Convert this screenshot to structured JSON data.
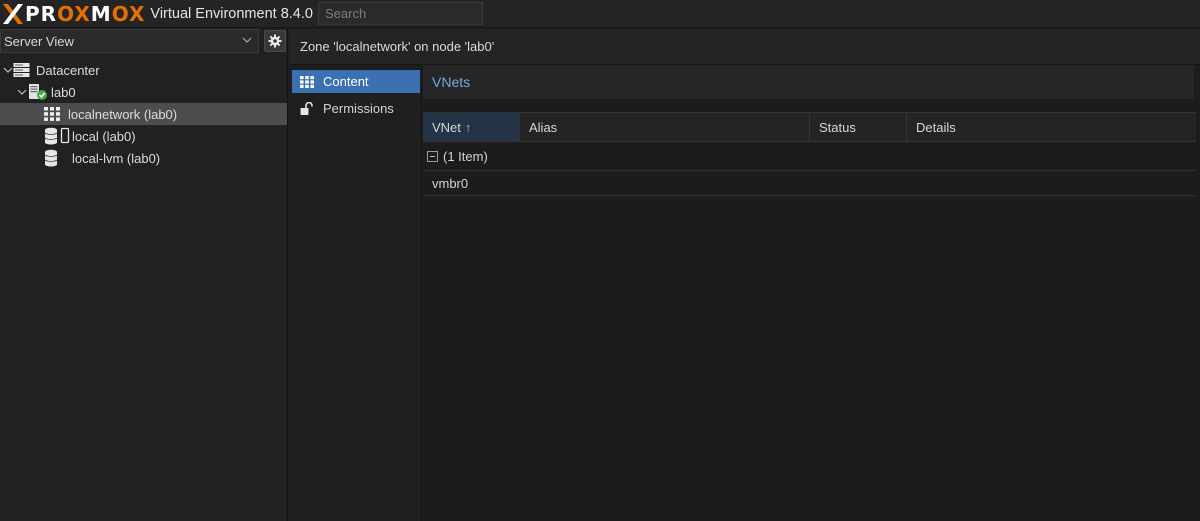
{
  "app": {
    "brand_prefix": "PR",
    "brand_ox1": "OX",
    "brand_m": "M",
    "brand_ox2": "OX",
    "title": "Virtual Environment 8.4.0",
    "search_placeholder": "Search"
  },
  "colors": {
    "accent_orange": "#e57000",
    "selected_blue": "#3b70b3",
    "panel_title_blue": "#78a9e2",
    "status_green": "#3fae49"
  },
  "left": {
    "view_selector": "Server View",
    "tree": [
      {
        "label": "Datacenter",
        "icon": "server-rack-icon"
      },
      {
        "label": "lab0",
        "icon": "node-online-icon"
      },
      {
        "label": "localnetwork (lab0)",
        "icon": "sdn-zone-grid-icon",
        "selected": true
      },
      {
        "label": "local (lab0)",
        "icon": "storage-database-icon"
      },
      {
        "label": "local-lvm (lab0)",
        "icon": "storage-database-icon"
      }
    ]
  },
  "main": {
    "header": "Zone 'localnetwork' on node 'lab0'",
    "nav": [
      {
        "label": "Content",
        "icon": "grid-icon",
        "active": true
      },
      {
        "label": "Permissions",
        "icon": "unlock-icon",
        "active": false
      }
    ],
    "panel_title": "VNets",
    "grid": {
      "columns": [
        "VNet",
        "Alias",
        "Status",
        "Details"
      ],
      "sort_indicator": "↑",
      "group_label": "(1 Item)",
      "rows": [
        {
          "vnet": "vmbr0",
          "alias": "",
          "status": "",
          "details": ""
        }
      ]
    }
  }
}
